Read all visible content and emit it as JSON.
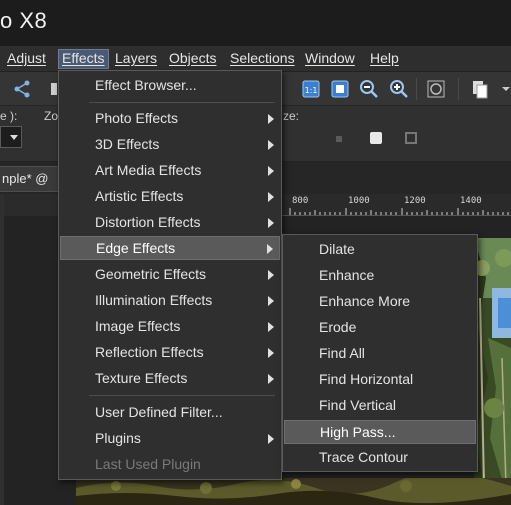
{
  "app": {
    "title": "o X8"
  },
  "menubar": {
    "items": [
      {
        "label": "Adjust"
      },
      {
        "label": "Effects"
      },
      {
        "label": "Layers"
      },
      {
        "label": "Objects"
      },
      {
        "label": "Selections"
      },
      {
        "label": "Window"
      },
      {
        "label": "Help"
      }
    ]
  },
  "propbar": {
    "label1": "e ):",
    "label2": "Zo",
    "label3": "ze:"
  },
  "document_tab": {
    "label": "nple* @"
  },
  "ruler": {
    "labels": [
      "800",
      "1000",
      "1200",
      "1400"
    ]
  },
  "effects_menu": {
    "items": [
      {
        "label": "Effect Browser..."
      },
      {
        "label": "Photo Effects"
      },
      {
        "label": "3D Effects"
      },
      {
        "label": "Art Media Effects"
      },
      {
        "label": "Artistic Effects"
      },
      {
        "label": "Distortion Effects"
      },
      {
        "label": "Edge Effects"
      },
      {
        "label": "Geometric Effects"
      },
      {
        "label": "Illumination Effects"
      },
      {
        "label": "Image Effects"
      },
      {
        "label": "Reflection Effects"
      },
      {
        "label": "Texture Effects"
      },
      {
        "label": "User Defined Filter..."
      },
      {
        "label": "Plugins"
      },
      {
        "label": "Last Used Plugin"
      }
    ]
  },
  "edge_menu": {
    "items": [
      {
        "label": "Dilate"
      },
      {
        "label": "Enhance"
      },
      {
        "label": "Enhance More"
      },
      {
        "label": "Erode"
      },
      {
        "label": "Find All"
      },
      {
        "label": "Find Horizontal"
      },
      {
        "label": "Find Vertical"
      },
      {
        "label": "High Pass..."
      },
      {
        "label": "Trace Contour"
      }
    ]
  },
  "colors": {
    "menu_active": "#4a5a72",
    "menu_highlight": "#5a5a5a",
    "disabled_text": "#7a7a7a"
  }
}
